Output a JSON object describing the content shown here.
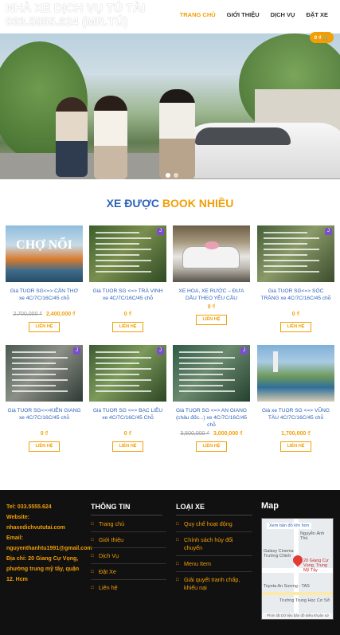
{
  "header": {
    "brand_line1": "NHÀ XE DỊCH VỤ TÚ TÀI",
    "brand_line2": "033.5555.624 (MR.TÚ)",
    "nav": [
      "TRANG CHỦ",
      "GIỚI THIỆU",
      "DỊCH VỤ",
      "ĐẶT XE"
    ]
  },
  "cart": {
    "count": "0",
    "currency": "₫"
  },
  "section": {
    "title_part1": "XE ĐƯỢC",
    "title_part2": "BOOK NHIỀU"
  },
  "products": [
    {
      "name": "Giá TUOR SG<=> CẦN THƠ xe 4C/7C/16C/45 chỗ",
      "old_price": "2,700,000 ₫",
      "price": "2,400,000 ₫",
      "button": "LIÊN HỆ"
    },
    {
      "name": "Giá TUOR SG <=> TRÀ VINH xe 4C/7C/16C/45 chỗ",
      "old_price": "",
      "price": "0 ₫",
      "button": "LIÊN HỆ"
    },
    {
      "name": "XE HOA, XE RƯỚC – ĐƯA DÂU THEO YÊU CẦU",
      "old_price": "",
      "price": "0 ₫",
      "button": "LIÊN HỆ"
    },
    {
      "name": "Giá TUOR SG<=> SÓC TRĂNG xe 4C/7C/16C/45 chỗ",
      "old_price": "",
      "price": "0 ₫",
      "button": "LIÊN HỆ"
    },
    {
      "name": "Giá TUOR SG<=>KIÊN GIANG xe 4C/7C/16C/45 chỗ",
      "old_price": "",
      "price": "0 ₫",
      "button": "LIÊN HỆ"
    },
    {
      "name": "Giá TUOR SG <=> BẠC LIÊU xe 4C/7C/16C/45 Chỗ",
      "old_price": "",
      "price": "0 ₫",
      "button": "LIÊN HỆ"
    },
    {
      "name": "Giá TUOR SG <=> AN GIANG (châu đốc...) xe 4C/7C/16C/45 chỗ",
      "old_price": "3,500,000 ₫",
      "price": "3,000,000 ₫",
      "button": "LIÊN HỆ"
    },
    {
      "name": "Giá xe TUOR SG <=> VŨNG TÀU 4C/7C/16C/45 chỗ",
      "old_price": "",
      "price": "1,700,000 ₫",
      "button": "LIÊN HỆ"
    }
  ],
  "thumbs": {
    "cho_noi": "CHỢ NỔI",
    "tag": "J"
  },
  "footer": {
    "contact": {
      "tel": "Tel: 033.5555.624",
      "website_label": "Website:",
      "website": "nhaxedichvututai.com",
      "email_label": "Email:",
      "email": "nguyenthanhtu1991@gmail.com",
      "address": "Địa chỉ: 20 Giang Cự Vọng, phường trung mỹ tây, quận 12. Hcm"
    },
    "info_title": "THÔNG TIN",
    "info_items": [
      "Trang chủ",
      "Giới thiệu",
      "Dịch Vụ",
      "Đặt Xe",
      "Liên hệ"
    ],
    "type_title": "LOẠI XE",
    "type_items": [
      "Quy chế hoạt động",
      "Chính sách hủy đổi chuyến",
      "Menu Item",
      "Giải quyết tranh chấp, khiếu nại"
    ],
    "map_title": "Map",
    "map": {
      "enlarge": "Xem bản đồ lớn hơn",
      "place": "20 Giang Cự Vọng, Trung Mỹ Tây",
      "cinema": "Galaxy Cinema Trường Chinh",
      "street1": "Nguyễn Ảnh Thủ",
      "street2": "Toyota An Sương - TAS",
      "school": "Trường Trung Học Cơ Sở",
      "footer": "Phím tắt  Dữ liệu bản đồ  Điều khoản sử dụng"
    }
  },
  "colors": {
    "accent": "#f29f05",
    "blue": "#2d63b8",
    "footer_bg": "#111111"
  }
}
